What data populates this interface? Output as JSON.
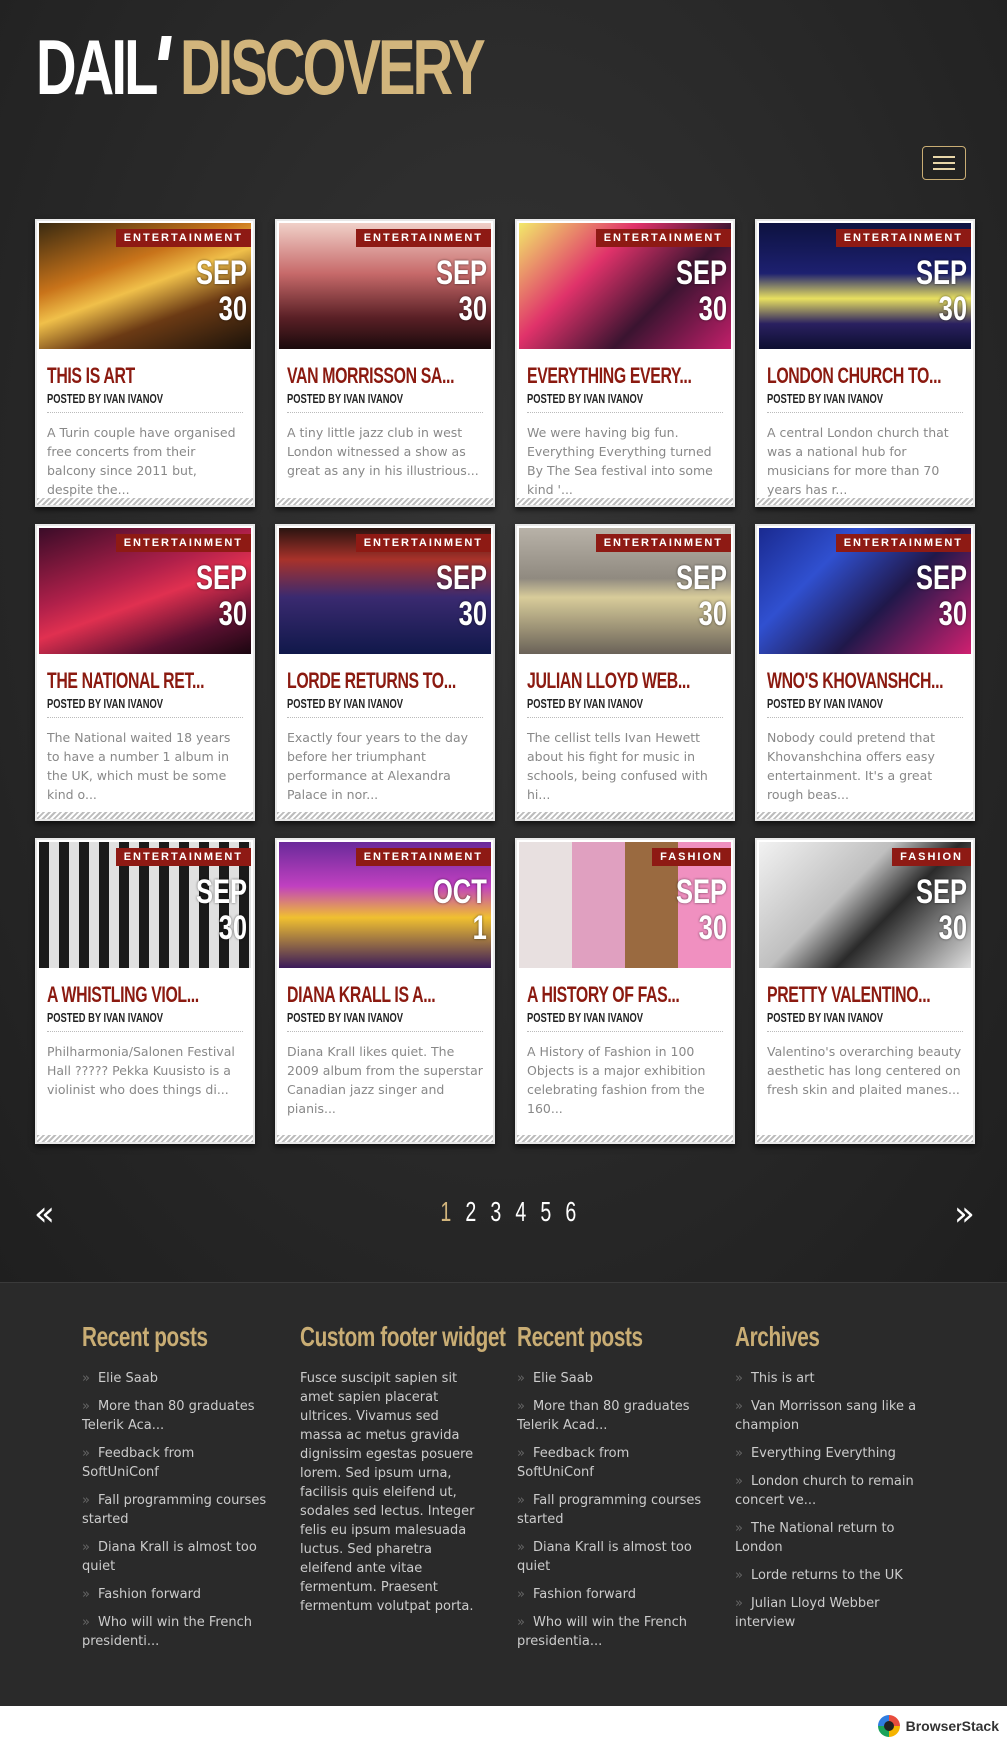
{
  "header": {
    "logo_part1": "DAIL",
    "logo_part2": "DISCOVERY"
  },
  "colors": {
    "accent_gold": "#d2b57c",
    "category_red": "#8e1a14",
    "title_red": "#8b1a10"
  },
  "cards": [
    {
      "category": "ENTERTAINMENT",
      "month": "SEP",
      "day": "30",
      "title": "THIS IS ART",
      "byline": "POSTED BY IVAN IVANOV",
      "excerpt": "A Turin couple have organised free concerts from their balcony since 2011 but, despite the...",
      "image": "concert-stage-performer"
    },
    {
      "category": "ENTERTAINMENT",
      "month": "SEP",
      "day": "30",
      "title": "VAN MORRISSON SA...",
      "byline": "POSTED BY IVAN IVANOV",
      "excerpt": "A tiny little jazz club in west London witnessed a show as great as any in his illustrious...",
      "image": "concert-crowd-hands"
    },
    {
      "category": "ENTERTAINMENT",
      "month": "SEP",
      "day": "30",
      "title": "EVERYTHING EVERY...",
      "byline": "POSTED BY IVAN IVANOV",
      "excerpt": "We were having big fun. Everything Everything turned By The Sea festival into some kind '...",
      "image": "singer-microphone"
    },
    {
      "category": "ENTERTAINMENT",
      "month": "SEP",
      "day": "30",
      "title": "LONDON CHURCH TO...",
      "byline": "POSTED BY IVAN IVANOV",
      "excerpt": "A central London church that was a national hub for musicians for more than 70 years has r...",
      "image": "dancers-stage"
    },
    {
      "category": "ENTERTAINMENT",
      "month": "SEP",
      "day": "30",
      "title": "THE NATIONAL RET...",
      "byline": "POSTED BY IVAN IVANOV",
      "excerpt": "The National waited 18 years to have a number 1 album in the UK, which must be some kind o...",
      "image": "musical-performance"
    },
    {
      "category": "ENTERTAINMENT",
      "month": "SEP",
      "day": "30",
      "title": "LORDE RETURNS TO...",
      "byline": "POSTED BY IVAN IVANOV",
      "excerpt": "Exactly four years to the day before her triumphant performance at Alexandra Palace in nor...",
      "image": "concert-hall-audience"
    },
    {
      "category": "ENTERTAINMENT",
      "month": "SEP",
      "day": "30",
      "title": "JULIAN LLOYD WEB...",
      "byline": "POSTED BY IVAN IVANOV",
      "excerpt": "The cellist tells Ivan Hewett about his fight for music in schools, being confused with hi...",
      "image": "woman-seated-steps"
    },
    {
      "category": "ENTERTAINMENT",
      "month": "SEP",
      "day": "30",
      "title": "WNO'S KHOVANSHCH...",
      "byline": "POSTED BY IVAN IVANOV",
      "excerpt": "Nobody could pretend that Khovanshchina offers easy entertainment. It's a great rough beas...",
      "image": "singer-blue-light"
    },
    {
      "category": "ENTERTAINMENT",
      "month": "SEP",
      "day": "30",
      "title": "A WHISTLING VIOL...",
      "byline": "POSTED BY IVAN IVANOV",
      "excerpt": "Philharmonia/Salonen Festival Hall ????? Pekka Kuusisto is a violinist who does things di...",
      "image": "hall-checker-floor"
    },
    {
      "category": "ENTERTAINMENT",
      "month": "OCT",
      "day": "1",
      "title": "DIANA KRALL IS A...",
      "byline": "POSTED BY IVAN IVANOV",
      "excerpt": "Diana Krall likes quiet. The 2009 album from the superstar Canadian jazz singer and pianis...",
      "image": "girl-group-stage"
    },
    {
      "category": "FASHION",
      "month": "SEP",
      "day": "30",
      "title": "A HISTORY OF FAS...",
      "byline": "POSTED BY IVAN IVANOV",
      "excerpt": "A History of Fashion in 100 Objects is a major exhibition celebrating fashion from the 160...",
      "image": "fashion-collage"
    },
    {
      "category": "FASHION",
      "month": "SEP",
      "day": "30",
      "title": "PRETTY VALENTINO...",
      "byline": "POSTED BY IVAN IVANOV",
      "excerpt": "Valentino's overarching beauty aesthetic has long centered on fresh skin and plaited manes...",
      "image": "designers-bw"
    }
  ],
  "pagination": {
    "prev": "«",
    "next": "»",
    "pages": [
      "1",
      "2",
      "3",
      "4",
      "5",
      "6"
    ],
    "active": "1"
  },
  "footer": {
    "col1": {
      "title": "Recent posts",
      "items": [
        "Elie Saab",
        "More than 80 graduates Telerik Aca...",
        "Feedback from SoftUniConf",
        "Fall programming courses started",
        "Diana Krall is almost too quiet",
        "Fashion forward",
        "Who will win the French presidenti..."
      ]
    },
    "col2": {
      "title": "Custom footer widget",
      "text": "Fusce suscipit sapien sit amet sapien placerat ultrices. Vivamus sed massa ac metus gravida dignissim egestas posuere lorem. Sed ipsum urna, facilisis quis eleifend ut, sodales sed lectus. Integer felis eu ipsum malesuada luctus. Sed pharetra eleifend ante vitae fermentum. Praesent fermentum volutpat porta."
    },
    "col3": {
      "title": "Recent posts",
      "items": [
        "Elie Saab",
        "More than 80 graduates Telerik Acad...",
        "Feedback from SoftUniConf",
        "Fall programming courses started",
        "Diana Krall is almost too quiet",
        "Fashion forward",
        "Who will win the French presidentia..."
      ]
    },
    "col4": {
      "title": "Archives",
      "items": [
        "This is art",
        "Van Morrisson sang like a champion",
        "Everything Everything",
        "London church to remain concert ve...",
        "The National return to London",
        "Lorde returns to the UK",
        "Julian Lloyd Webber interview"
      ]
    }
  },
  "browserstack": {
    "label": "BrowserStack"
  }
}
